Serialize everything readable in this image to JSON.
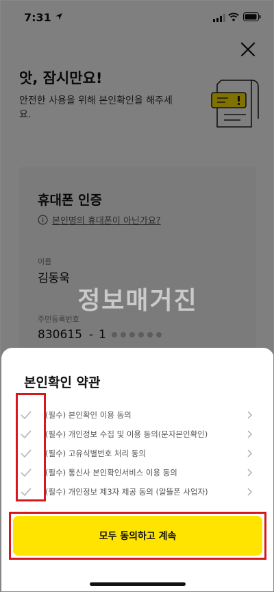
{
  "status": {
    "time": "7:31"
  },
  "page": {
    "heading": "앗, 잠시만요!",
    "subtitle": "안전한 사용을 위해 본인확인을 해주세요."
  },
  "card": {
    "title": "휴대폰 인증",
    "not_mine": "본인명의 휴대폰이 아닌가요?",
    "name_label": "이름",
    "name_value": "김동욱",
    "rrn_label": "주민등록번호",
    "rrn_front": "830615",
    "rrn_dash": "-",
    "rrn_first_digit": "1"
  },
  "watermark": "정보매거진",
  "sheet": {
    "title": "본인확인 약관",
    "terms": [
      {
        "label": "(필수) 본인확인 이용 동의"
      },
      {
        "label": "(필수) 개인정보 수집 및 이용 동의(문자본인확인)"
      },
      {
        "label": "(필수) 고유식별번호 처리 동의"
      },
      {
        "label": "(필수) 통신사 본인확인서비스 이용 동의"
      },
      {
        "label": "(필수) 개인정보 제3자 제공 동의 (알뜰폰 사업자)"
      }
    ],
    "cta": "모두 동의하고 계속"
  },
  "colors": {
    "accent": "#ffe400",
    "highlight": "#d8171d"
  }
}
